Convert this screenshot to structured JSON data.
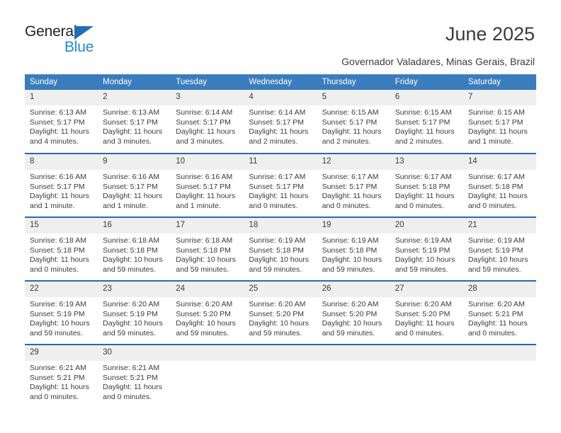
{
  "brand": {
    "name_part1": "General",
    "name_part2": "Blue",
    "triangle_icon": "triangle-icon",
    "accent_blue": "#2389d6",
    "dark": "#231f20"
  },
  "header": {
    "title": "June 2025",
    "subtitle": "Governador Valadares, Minas Gerais, Brazil"
  },
  "colors": {
    "header_band": "#3a7dbd",
    "row_divider": "#2a6aa8",
    "daynum_band": "#efefef",
    "text": "#3b3b3b"
  },
  "weekday_headers": [
    "Sunday",
    "Monday",
    "Tuesday",
    "Wednesday",
    "Thursday",
    "Friday",
    "Saturday"
  ],
  "weeks": [
    [
      {
        "day": "1",
        "sunrise": "Sunrise: 6:13 AM",
        "sunset": "Sunset: 5:17 PM",
        "daylight": "Daylight: 11 hours and 4 minutes."
      },
      {
        "day": "2",
        "sunrise": "Sunrise: 6:13 AM",
        "sunset": "Sunset: 5:17 PM",
        "daylight": "Daylight: 11 hours and 3 minutes."
      },
      {
        "day": "3",
        "sunrise": "Sunrise: 6:14 AM",
        "sunset": "Sunset: 5:17 PM",
        "daylight": "Daylight: 11 hours and 3 minutes."
      },
      {
        "day": "4",
        "sunrise": "Sunrise: 6:14 AM",
        "sunset": "Sunset: 5:17 PM",
        "daylight": "Daylight: 11 hours and 2 minutes."
      },
      {
        "day": "5",
        "sunrise": "Sunrise: 6:15 AM",
        "sunset": "Sunset: 5:17 PM",
        "daylight": "Daylight: 11 hours and 2 minutes."
      },
      {
        "day": "6",
        "sunrise": "Sunrise: 6:15 AM",
        "sunset": "Sunset: 5:17 PM",
        "daylight": "Daylight: 11 hours and 2 minutes."
      },
      {
        "day": "7",
        "sunrise": "Sunrise: 6:15 AM",
        "sunset": "Sunset: 5:17 PM",
        "daylight": "Daylight: 11 hours and 1 minute."
      }
    ],
    [
      {
        "day": "8",
        "sunrise": "Sunrise: 6:16 AM",
        "sunset": "Sunset: 5:17 PM",
        "daylight": "Daylight: 11 hours and 1 minute."
      },
      {
        "day": "9",
        "sunrise": "Sunrise: 6:16 AM",
        "sunset": "Sunset: 5:17 PM",
        "daylight": "Daylight: 11 hours and 1 minute."
      },
      {
        "day": "10",
        "sunrise": "Sunrise: 6:16 AM",
        "sunset": "Sunset: 5:17 PM",
        "daylight": "Daylight: 11 hours and 1 minute."
      },
      {
        "day": "11",
        "sunrise": "Sunrise: 6:17 AM",
        "sunset": "Sunset: 5:17 PM",
        "daylight": "Daylight: 11 hours and 0 minutes."
      },
      {
        "day": "12",
        "sunrise": "Sunrise: 6:17 AM",
        "sunset": "Sunset: 5:17 PM",
        "daylight": "Daylight: 11 hours and 0 minutes."
      },
      {
        "day": "13",
        "sunrise": "Sunrise: 6:17 AM",
        "sunset": "Sunset: 5:18 PM",
        "daylight": "Daylight: 11 hours and 0 minutes."
      },
      {
        "day": "14",
        "sunrise": "Sunrise: 6:17 AM",
        "sunset": "Sunset: 5:18 PM",
        "daylight": "Daylight: 11 hours and 0 minutes."
      }
    ],
    [
      {
        "day": "15",
        "sunrise": "Sunrise: 6:18 AM",
        "sunset": "Sunset: 5:18 PM",
        "daylight": "Daylight: 11 hours and 0 minutes."
      },
      {
        "day": "16",
        "sunrise": "Sunrise: 6:18 AM",
        "sunset": "Sunset: 5:18 PM",
        "daylight": "Daylight: 10 hours and 59 minutes."
      },
      {
        "day": "17",
        "sunrise": "Sunrise: 6:18 AM",
        "sunset": "Sunset: 5:18 PM",
        "daylight": "Daylight: 10 hours and 59 minutes."
      },
      {
        "day": "18",
        "sunrise": "Sunrise: 6:19 AM",
        "sunset": "Sunset: 5:18 PM",
        "daylight": "Daylight: 10 hours and 59 minutes."
      },
      {
        "day": "19",
        "sunrise": "Sunrise: 6:19 AM",
        "sunset": "Sunset: 5:18 PM",
        "daylight": "Daylight: 10 hours and 59 minutes."
      },
      {
        "day": "20",
        "sunrise": "Sunrise: 6:19 AM",
        "sunset": "Sunset: 5:19 PM",
        "daylight": "Daylight: 10 hours and 59 minutes."
      },
      {
        "day": "21",
        "sunrise": "Sunrise: 6:19 AM",
        "sunset": "Sunset: 5:19 PM",
        "daylight": "Daylight: 10 hours and 59 minutes."
      }
    ],
    [
      {
        "day": "22",
        "sunrise": "Sunrise: 6:19 AM",
        "sunset": "Sunset: 5:19 PM",
        "daylight": "Daylight: 10 hours and 59 minutes."
      },
      {
        "day": "23",
        "sunrise": "Sunrise: 6:20 AM",
        "sunset": "Sunset: 5:19 PM",
        "daylight": "Daylight: 10 hours and 59 minutes."
      },
      {
        "day": "24",
        "sunrise": "Sunrise: 6:20 AM",
        "sunset": "Sunset: 5:20 PM",
        "daylight": "Daylight: 10 hours and 59 minutes."
      },
      {
        "day": "25",
        "sunrise": "Sunrise: 6:20 AM",
        "sunset": "Sunset: 5:20 PM",
        "daylight": "Daylight: 10 hours and 59 minutes."
      },
      {
        "day": "26",
        "sunrise": "Sunrise: 6:20 AM",
        "sunset": "Sunset: 5:20 PM",
        "daylight": "Daylight: 10 hours and 59 minutes."
      },
      {
        "day": "27",
        "sunrise": "Sunrise: 6:20 AM",
        "sunset": "Sunset: 5:20 PM",
        "daylight": "Daylight: 11 hours and 0 minutes."
      },
      {
        "day": "28",
        "sunrise": "Sunrise: 6:20 AM",
        "sunset": "Sunset: 5:21 PM",
        "daylight": "Daylight: 11 hours and 0 minutes."
      }
    ],
    [
      {
        "day": "29",
        "sunrise": "Sunrise: 6:21 AM",
        "sunset": "Sunset: 5:21 PM",
        "daylight": "Daylight: 11 hours and 0 minutes."
      },
      {
        "day": "30",
        "sunrise": "Sunrise: 6:21 AM",
        "sunset": "Sunset: 5:21 PM",
        "daylight": "Daylight: 11 hours and 0 minutes."
      },
      {
        "day": "",
        "sunrise": "",
        "sunset": "",
        "daylight": ""
      },
      {
        "day": "",
        "sunrise": "",
        "sunset": "",
        "daylight": ""
      },
      {
        "day": "",
        "sunrise": "",
        "sunset": "",
        "daylight": ""
      },
      {
        "day": "",
        "sunrise": "",
        "sunset": "",
        "daylight": ""
      },
      {
        "day": "",
        "sunrise": "",
        "sunset": "",
        "daylight": ""
      }
    ]
  ]
}
